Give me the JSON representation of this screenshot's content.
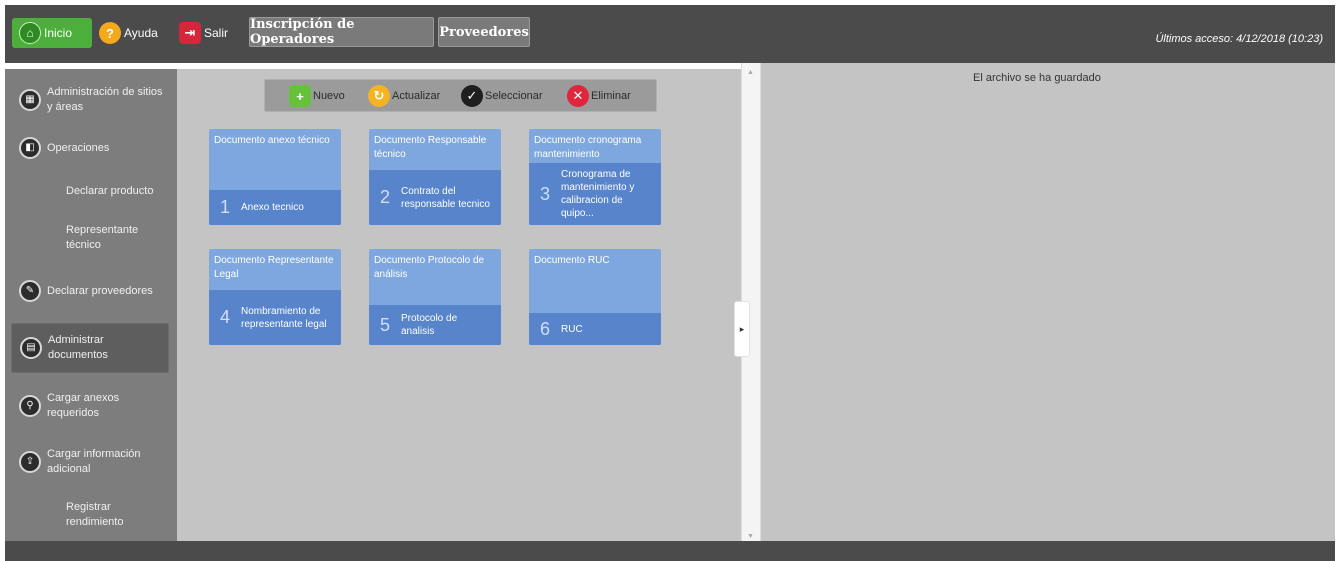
{
  "topbar": {
    "inicio": "Inicio",
    "ayuda": "Ayuda",
    "salir": "Salir",
    "tabs": [
      "Inscripción de Operadores",
      "Proveedores"
    ],
    "last_access": "Últimos acceso: 4/12/2018 (10:23)"
  },
  "sidebar": {
    "items": [
      {
        "label": "Administración de sitios y áreas",
        "icon": "sites-icon"
      },
      {
        "label": "Operaciones",
        "icon": "operations-icon"
      },
      {
        "label": "Declarar producto",
        "icon": ""
      },
      {
        "label": "Representante técnico",
        "icon": ""
      },
      {
        "label": "Declarar proveedores",
        "icon": "providers-icon"
      },
      {
        "label": "Administrar documentos",
        "icon": "documents-icon"
      },
      {
        "label": "Cargar anexos requeridos",
        "icon": "attachments-icon"
      },
      {
        "label": "Cargar información adicional",
        "icon": "upload-info-icon"
      },
      {
        "label": "Registrar rendimiento",
        "icon": ""
      }
    ],
    "active_index": 5
  },
  "toolbar": {
    "nuevo": "Nuevo",
    "actualizar": "Actualizar",
    "seleccionar": "Seleccionar",
    "eliminar": "Eliminar"
  },
  "tiles": [
    {
      "title": "Documento anexo técnico",
      "num": "1",
      "desc": "Anexo tecnico"
    },
    {
      "title": "Documento Responsable técnico",
      "num": "2",
      "desc": "Contrato del responsable tecnico"
    },
    {
      "title": "Documento cronograma mantenimiento",
      "num": "3",
      "desc": "Cronograma de mantenimiento y calibracion de quipo..."
    },
    {
      "title": "Documento Representante Legal",
      "num": "4",
      "desc": "Nombramiento de representante legal"
    },
    {
      "title": "Documento Protocolo de análisis",
      "num": "5",
      "desc": "Protocolo de analisis"
    },
    {
      "title": "Documento RUC",
      "num": "6",
      "desc": "RUC"
    }
  ],
  "right_panel": {
    "message": "El archivo se ha guardado"
  },
  "colors": {
    "topbar": "#4b4b4b",
    "tile_light": "#7da7de",
    "tile_dark": "#5784ca",
    "inicio_green": "#4cae3b"
  }
}
